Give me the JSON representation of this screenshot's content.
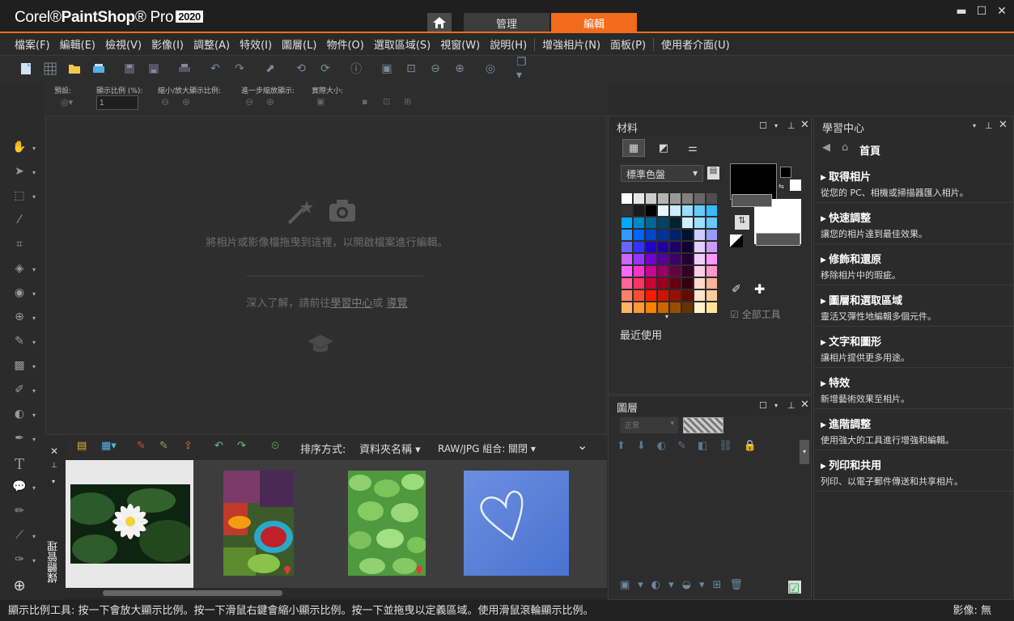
{
  "app": {
    "logo_corel": "Corel",
    "logo_name": "PaintShop",
    "logo_pro": "Pro",
    "logo_year": "2020",
    "tab_manage": "管理",
    "tab_edit": "編輯"
  },
  "menu": [
    "檔案(F)",
    "編輯(E)",
    "檢視(V)",
    "影像(I)",
    "調整(A)",
    "特效(I)",
    "圖層(L)",
    "物件(O)",
    "選取區域(S)",
    "視窗(W)",
    "說明(H)",
    "增強相片(N)",
    "面板(P)",
    "使用者介面(U)"
  ],
  "tool_options": {
    "preset": "預設:",
    "zoom_percent": "顯示比例 (%):",
    "zoom_value": "1",
    "zoom_inout": "縮小/放大顯示比例:",
    "zoom_more": "進一步縮放顯示:",
    "actual_size": "實際大小:"
  },
  "canvas": {
    "drop_text": "將相片或影像檔拖曳到這裡，以開啟檔案進行編輯。",
    "learn_prefix": "深入了解，請前往",
    "learn_link": "學習中心",
    "learn_or": "或",
    "tour_link": "導覽"
  },
  "organizer": {
    "sort_label": "排序方式:",
    "sort_value": "資料夾名稱",
    "raw_label": "RAW/JPG 組合: 關閉",
    "side_title": "媒體管理"
  },
  "materials": {
    "title": "材料",
    "palette": "標準色盤",
    "all_tools": "全部工具",
    "recent": "最近使用",
    "swatch_colors": [
      "#ffffff",
      "#e6e6e6",
      "#cccccc",
      "#b3b3b3",
      "#999999",
      "#808080",
      "#666666",
      "#4d4d4d",
      "#333333",
      "#1a1a1a",
      "#000000",
      "#e6f7ff",
      "#cceeff",
      "#99ddff",
      "#66ccff",
      "#33bbff",
      "#00aaff",
      "#0088cc",
      "#006699",
      "#004466",
      "#002233",
      "#ccf0ff",
      "#99e0ff",
      "#66c8ff",
      "#3399ff",
      "#0066ff",
      "#0044cc",
      "#003399",
      "#002266",
      "#001133",
      "#ccccff",
      "#9999ff",
      "#6666ff",
      "#3333ff",
      "#2200cc",
      "#220099",
      "#1a0066",
      "#0d0033",
      "#e6ccff",
      "#cc99ff",
      "#cc66ff",
      "#9933ff",
      "#7700cc",
      "#550099",
      "#3d0066",
      "#220033",
      "#f2ccff",
      "#ff99ff",
      "#ff66ff",
      "#ff33cc",
      "#cc0099",
      "#990066",
      "#660044",
      "#330022",
      "#ffcce6",
      "#ff99cc",
      "#ff6699",
      "#ff3366",
      "#cc0033",
      "#990022",
      "#660011",
      "#330011",
      "#ffd9cc",
      "#ffb399",
      "#ff8066",
      "#ff4d33",
      "#ff1a00",
      "#cc1400",
      "#990f00",
      "#660a00",
      "#ffe6cc",
      "#ffcc99",
      "#ffb366",
      "#ff9933",
      "#ff8000",
      "#cc6600",
      "#994d00",
      "#663300",
      "#fff2cc",
      "#ffe599",
      "#ffd966",
      "#ffcc33",
      "#ffbf00",
      "#cc9900",
      "#997300",
      "#664d00"
    ]
  },
  "layers": {
    "title": "圖層",
    "blend_mode": "正常"
  },
  "learning": {
    "title": "學習中心",
    "home": "首頁",
    "items": [
      {
        "title": "取得相片",
        "desc": "從您的 PC、相機或掃描器匯入相片。"
      },
      {
        "title": "快速調整",
        "desc": "讓您的相片達到最佳效果。"
      },
      {
        "title": "修飾和還原",
        "desc": "移除相片中的瑕疵。"
      },
      {
        "title": "圖層和選取區域",
        "desc": "靈活又彈性地編輯多個元件。"
      },
      {
        "title": "文字和圖形",
        "desc": "讓相片提供更多用途。"
      },
      {
        "title": "特效",
        "desc": "新增藝術效果至相片。"
      },
      {
        "title": "進階調整",
        "desc": "使用強大的工具進行增強和編輯。"
      },
      {
        "title": "列印和共用",
        "desc": "列印、以電子郵件傳送和共享相片。"
      }
    ]
  },
  "status": {
    "hint": "顯示比例工具: 按一下會放大顯示比例。按一下滑鼠右鍵會縮小顯示比例。按一下並拖曳以定義區域。使用滑鼠滾輪顯示比例。",
    "image_info": "影像: 無"
  },
  "icons": [
    "home-icon",
    "new-file-icon",
    "grid-icon",
    "open-folder-icon",
    "scan-icon",
    "save-icon",
    "save-as-icon",
    "print-icon",
    "undo-icon",
    "redo-icon",
    "resize-icon",
    "zoom-in-icon",
    "zoom-out-icon",
    "info-icon",
    "pan-tool-icon",
    "pick-tool-icon",
    "selection-icon",
    "dropper-icon",
    "crop-icon",
    "straighten-icon",
    "red-eye-icon",
    "clone-icon",
    "brush-icon",
    "fill-icon",
    "eraser-icon",
    "paint-icon",
    "text-icon",
    "speech-shape-icon",
    "pen-icon",
    "airbrush-icon",
    "add-icon",
    "magic-wand-icon",
    "camera-icon",
    "grad-cap-icon"
  ]
}
